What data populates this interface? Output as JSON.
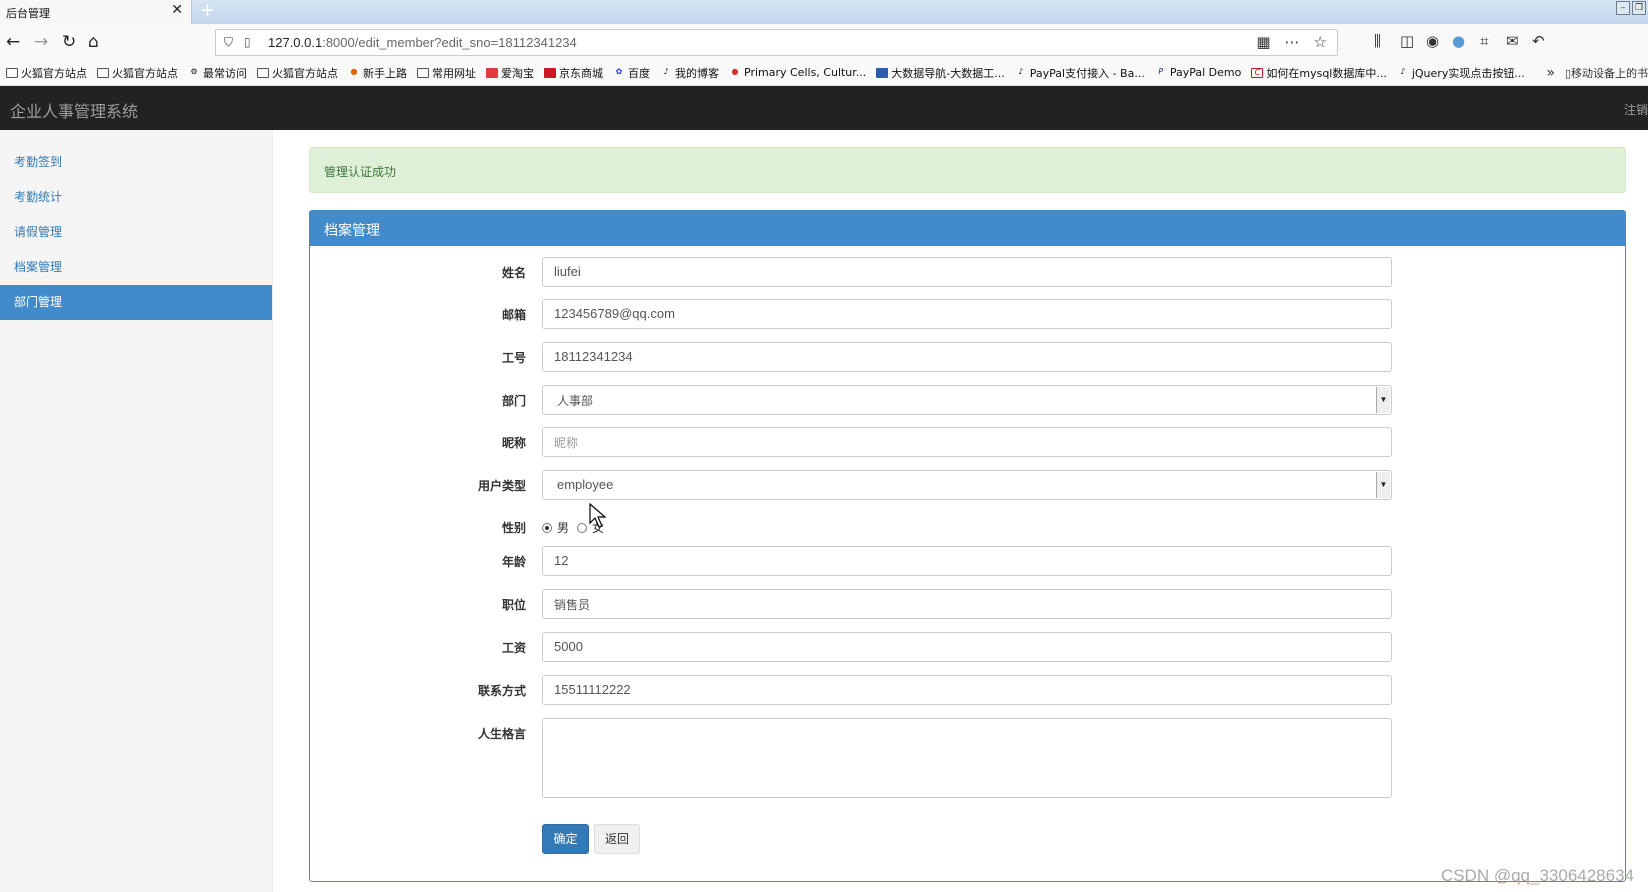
{
  "browser": {
    "tab_title": "后台管理",
    "tab_close": "✕",
    "new_tab": "+",
    "url_host": "127.0.0.1",
    "url_rest": ":8000/edit_member?edit_sno=18112341234",
    "bookmarks": [
      "火狐官方站点",
      "火狐官方站点",
      "最常访问",
      "火狐官方站点",
      "新手上路",
      "常用网址",
      "爱淘宝",
      "京东商城",
      "百度",
      "我的博客",
      "Primary Cells, Cultur...",
      "大数据导航-大数据工...",
      "PayPal支付接入 - Ba...",
      "PayPal Demo",
      "如何在mysql数据库中...",
      "jQuery实现点击按钮..."
    ],
    "bookmark_more": "»",
    "bookmark_mobile": "移动设备上的书"
  },
  "app": {
    "title": "企业人事管理系统",
    "logout": "注销"
  },
  "sidebar": {
    "items": [
      {
        "label": "考勤签到"
      },
      {
        "label": "考勤统计"
      },
      {
        "label": "请假管理"
      },
      {
        "label": "档案管理"
      },
      {
        "label": "部门管理"
      }
    ]
  },
  "alert": "管理认证成功",
  "panel": {
    "title": "档案管理"
  },
  "form": {
    "name_label": "姓名",
    "name_value": "liufei",
    "email_label": "邮箱",
    "email_value": "123456789@qq.com",
    "sno_label": "工号",
    "sno_value": "18112341234",
    "dept_label": "部门",
    "dept_value": "人事部",
    "nick_label": "昵称",
    "nick_placeholder": "昵称",
    "usertype_label": "用户类型",
    "usertype_value": "employee",
    "gender_label": "性别",
    "gender_male": "男",
    "gender_female": "女",
    "age_label": "年龄",
    "age_value": "12",
    "position_label": "职位",
    "position_value": "销售员",
    "salary_label": "工资",
    "salary_value": "5000",
    "contact_label": "联系方式",
    "contact_value": "15511112222",
    "motto_label": "人生格言",
    "submit_label": "确定",
    "back_label": "返回"
  },
  "watermark": "CSDN @qq_3306428634"
}
